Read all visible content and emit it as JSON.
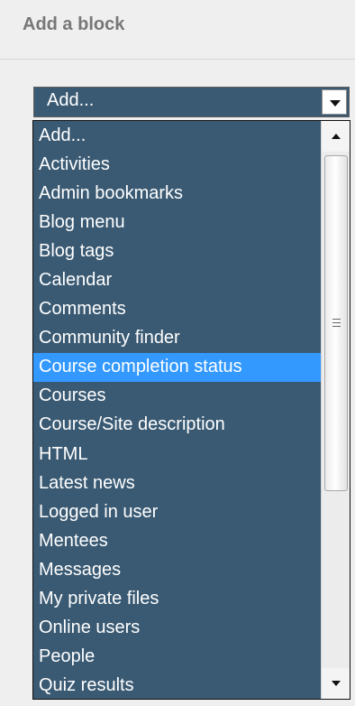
{
  "block": {
    "title": "Add a block"
  },
  "select": {
    "current_value": "Add...",
    "options": [
      "Add...",
      "Activities",
      "Admin bookmarks",
      "Blog menu",
      "Blog tags",
      "Calendar",
      "Comments",
      "Community finder",
      "Course completion status",
      "Courses",
      "Course/Site description",
      "HTML",
      "Latest news",
      "Logged in user",
      "Mentees",
      "Messages",
      "My private files",
      "Online users",
      "People",
      "Quiz results"
    ],
    "highlighted_option": "Course completion status"
  },
  "icons": {
    "select_arrow": "chevron-down-icon",
    "scroll_up": "scroll-up-arrow-icon",
    "scroll_down": "scroll-down-arrow-icon",
    "grip": "scroll-grip-icon"
  },
  "colors": {
    "select_background": "#3a5a73",
    "highlight": "#3399ff",
    "text": "#ffffff",
    "title": "#777777",
    "panel_background": "#efefef"
  }
}
